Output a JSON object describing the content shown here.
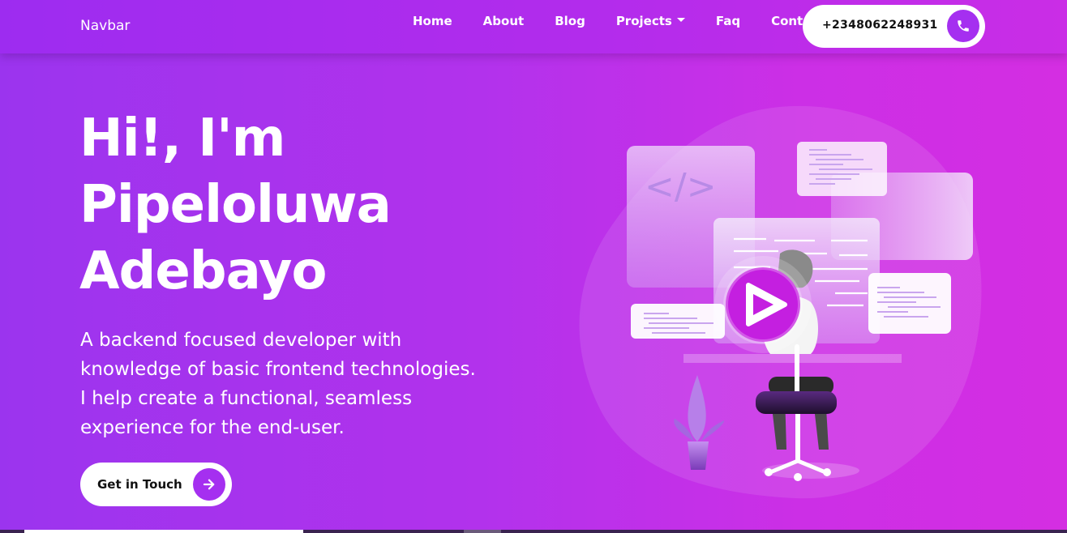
{
  "navbar": {
    "brand": "Navbar",
    "links": [
      "Home",
      "About",
      "Blog",
      "Projects",
      "Faq",
      "Contact"
    ],
    "phone": "+2348062248931"
  },
  "hero": {
    "title_lines": [
      "Hi!, I'm",
      "Pipeloluwa",
      "Adebayo"
    ],
    "description_lines": [
      "A backend focused developer with",
      "knowledge of basic frontend technologies.",
      "I help create a functional, seamless",
      "experience for the end-user."
    ],
    "cta_label": "Get in Touch"
  },
  "illustration": {
    "code_tag": "</>"
  },
  "icons": {
    "phone": "phone-icon",
    "arrow": "arrow-right-icon",
    "play": "play-icon",
    "dropdown": "caret-down-icon"
  },
  "colors": {
    "accent": "#a52ff0",
    "gradient_start": "#9b34ee",
    "gradient_end": "#d42ee2",
    "play_button": "#c41fe0"
  }
}
